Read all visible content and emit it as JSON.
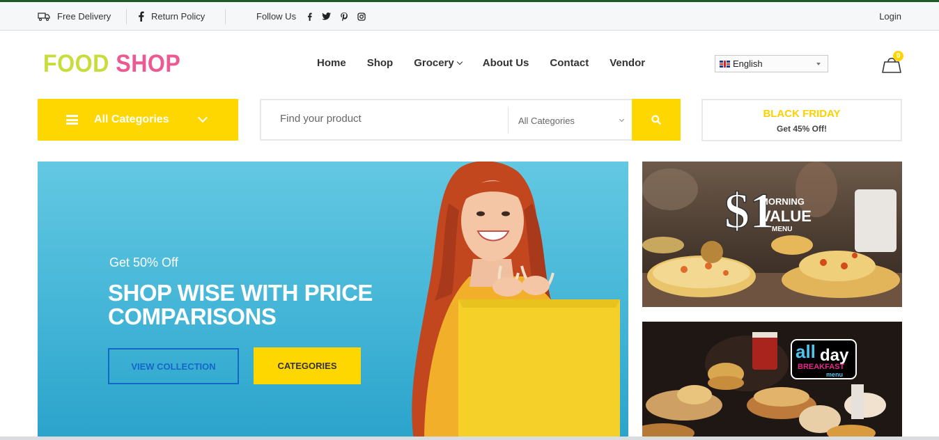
{
  "topbar": {
    "free_delivery": "Free Delivery",
    "return_policy": "Return Policy",
    "follow_us": "Follow Us",
    "login": "Login",
    "social": [
      "facebook-icon",
      "twitter-icon",
      "pinterest-icon",
      "instagram-icon"
    ]
  },
  "brand": {
    "word1": "FOOD",
    "word2": "SHOP",
    "color1": "#c8dc3c",
    "color2": "#ec5a94"
  },
  "nav": {
    "items": [
      "Home",
      "Shop",
      "Grocery",
      "About Us",
      "Contact",
      "Vendor"
    ]
  },
  "language": {
    "selected": "English"
  },
  "cart": {
    "count": "0"
  },
  "categories_button": {
    "label": "All Categories"
  },
  "search": {
    "placeholder": "Find your product",
    "category_selected": "All Categories"
  },
  "promo": {
    "title": "BLACK FRIDAY",
    "subtitle": "Get 45% Off!"
  },
  "hero": {
    "subtitle": "Get 50% Off",
    "headline_line1": "SHOP WISE WITH PRICE",
    "headline_line2": "COMPARISONS",
    "button_primary": "VIEW COLLECTION",
    "button_secondary": "CATEGORIES"
  },
  "side_banners": {
    "banner1": {
      "price": "$1",
      "line1": "MORNING",
      "line2": "VALUE",
      "line3": "MENU"
    },
    "banner2": {
      "word1": "all",
      "word2": "day",
      "line2": "BREAKFAST",
      "line3": "menu"
    }
  },
  "colors": {
    "accent_yellow": "#ffd700",
    "link_blue": "#1467c7",
    "top_line": "#1f5a2a"
  }
}
